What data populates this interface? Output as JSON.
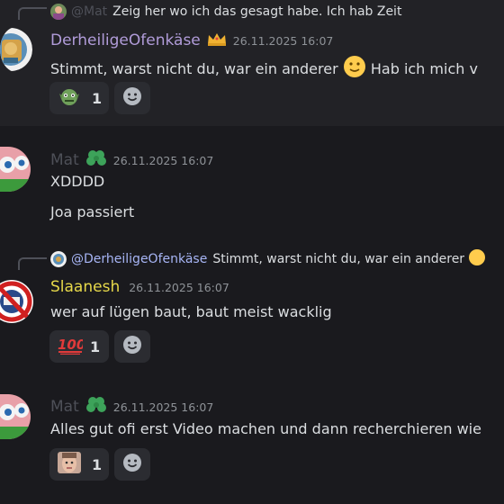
{
  "colors": {
    "background": "#1a1a1e",
    "highlight_row": "#222226",
    "ofen_name": "#b19cd9",
    "slaanesh_name": "#e6d84a",
    "mat_name_muted": "#4e5058",
    "mention": "#a7b5f5",
    "reaction_bg": "#2b2c31"
  },
  "messages": [
    {
      "reply": {
        "author": "@Mat",
        "text": "Zeig her wo ich das gesagt habe. Ich hab Zeit"
      },
      "author": "DerheiligeOfenkäse",
      "badge_icon": "crown-icon",
      "timestamp": "26.11.2025 16:07",
      "lines": [
        "Stimmt, warst nicht du, war ein anderer",
        "Hab ich mich v"
      ],
      "reaction": {
        "emoji": "goblin-emoji",
        "count": "1"
      }
    },
    {
      "author": "Mat",
      "badge_icon": "clover-icon",
      "timestamp": "26.11.2025 16:07",
      "lines": [
        "XDDDD",
        "Joa passiert"
      ]
    },
    {
      "reply": {
        "author": "@DerheiligeOfenkäse",
        "text": "Stimmt, warst nicht du, war ein anderer"
      },
      "author": "Slaanesh",
      "timestamp": "26.11.2025 16:07",
      "lines": [
        "wer auf lügen baut, baut meist wacklig"
      ],
      "reaction": {
        "emoji": "100-emoji",
        "count": "1"
      }
    },
    {
      "author": "Mat",
      "badge_icon": "clover-icon",
      "timestamp": "26.11.2025 16:07",
      "lines": [
        "Alles gut ofi erst Video machen und dann recherchieren wie"
      ],
      "reaction": {
        "emoji": "face-photo-emoji",
        "count": "1"
      }
    }
  ]
}
